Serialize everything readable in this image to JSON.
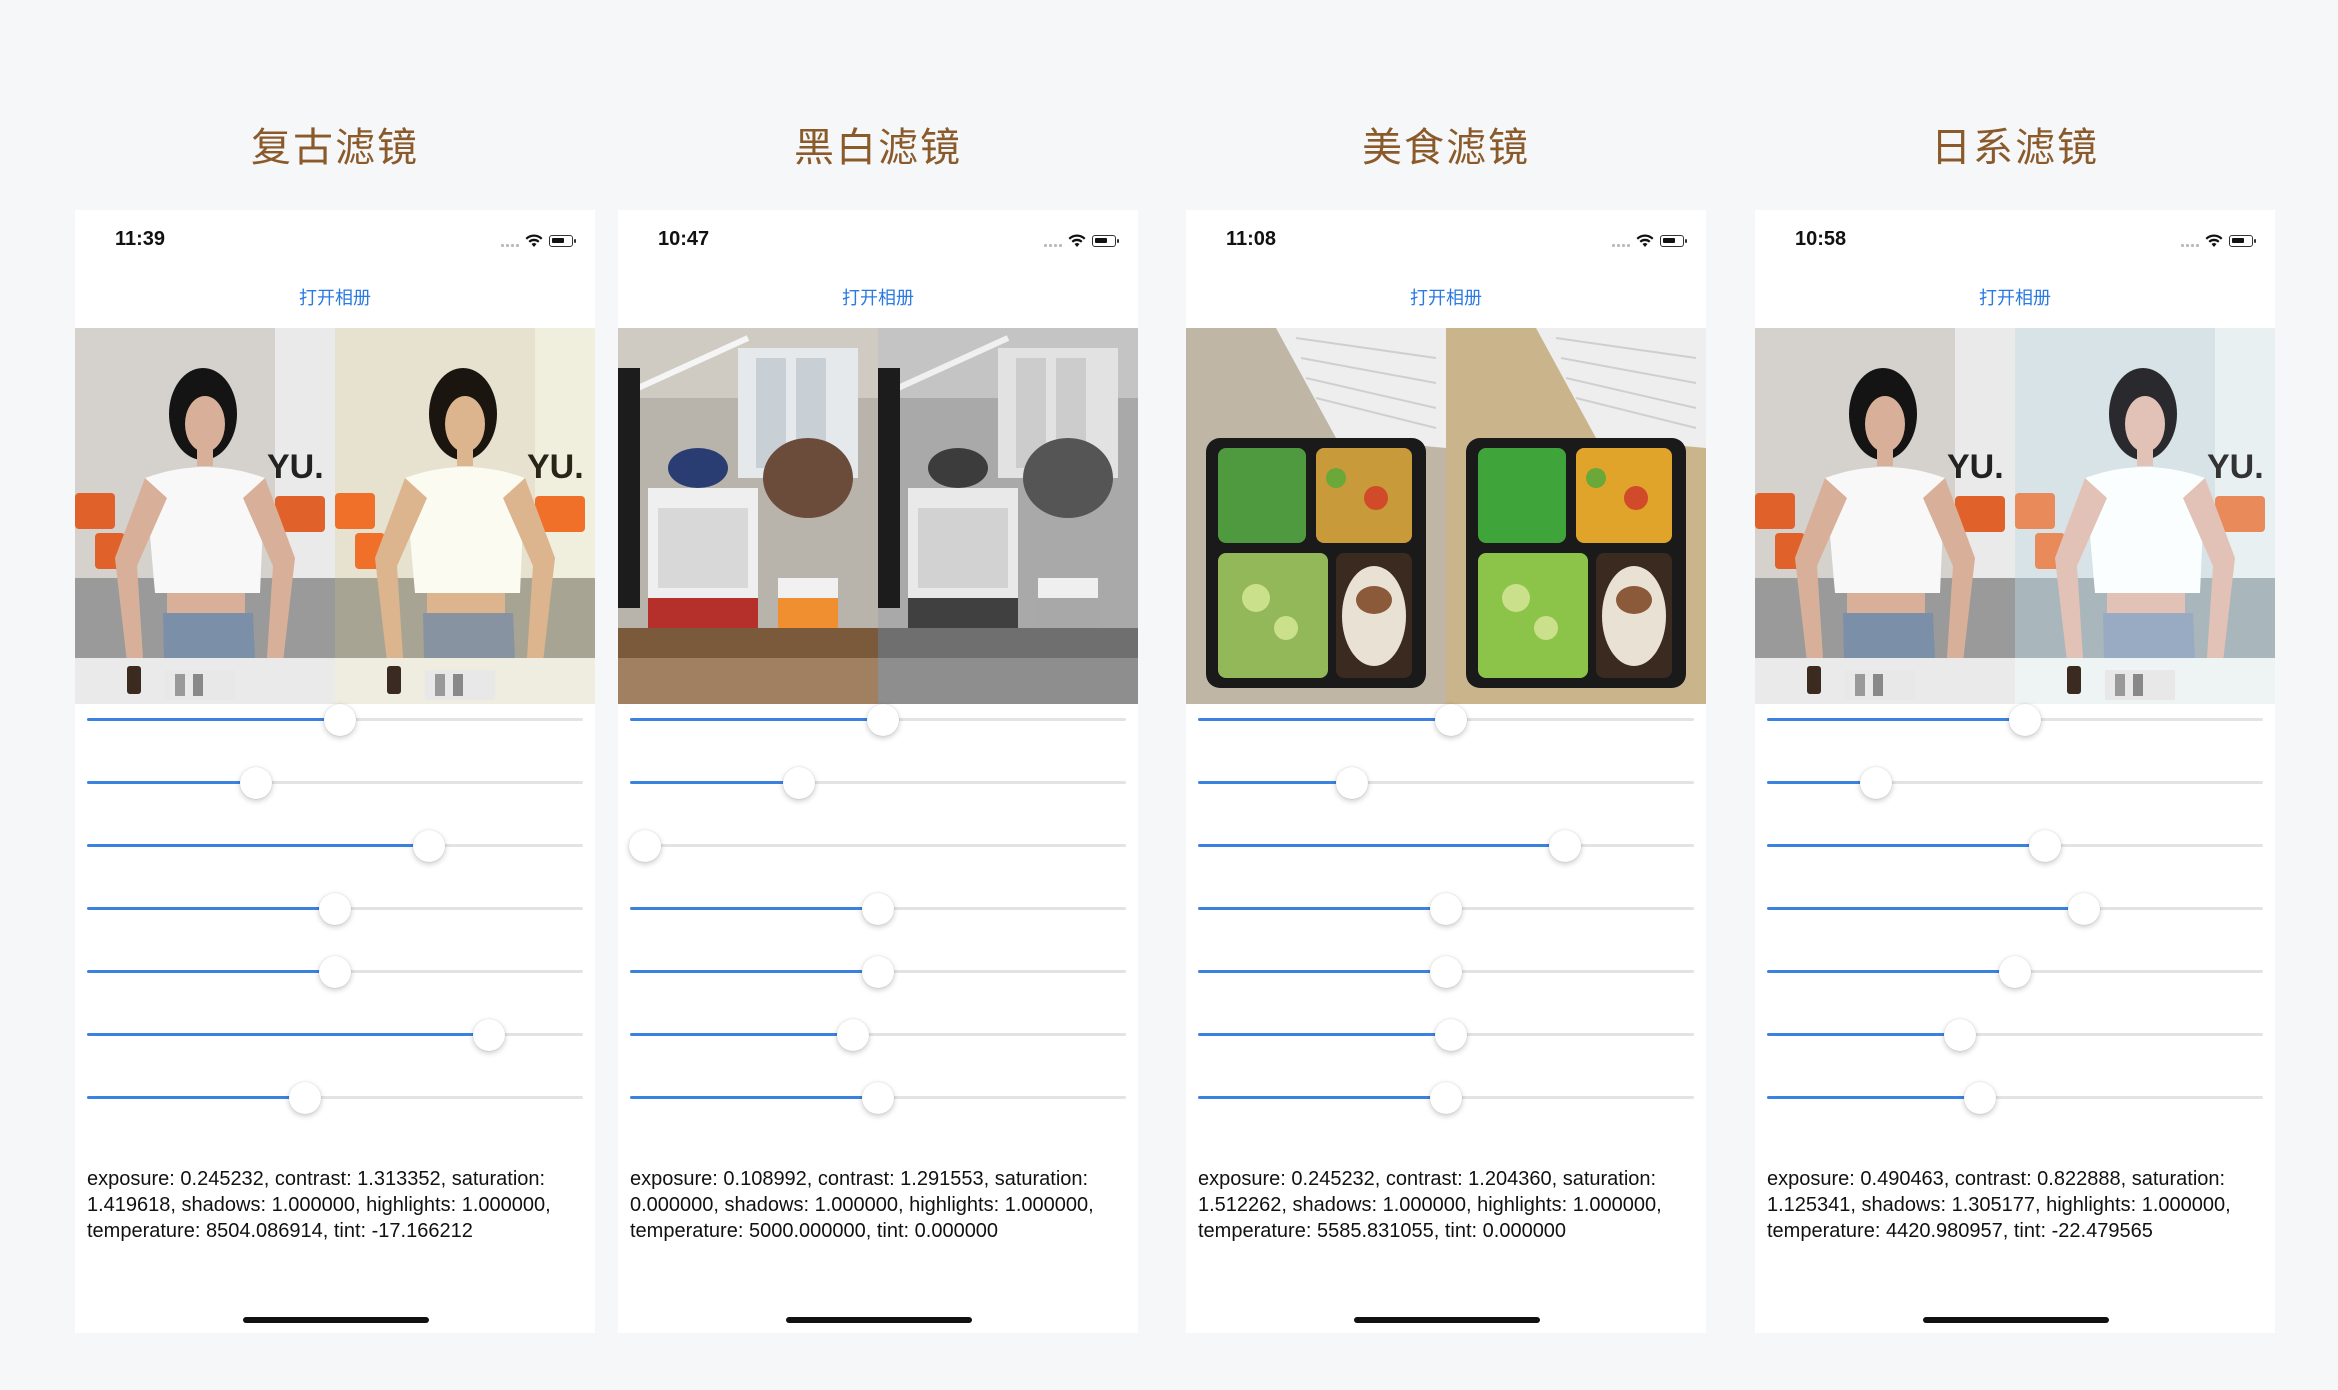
{
  "filters": [
    {
      "title": "复古滤镜",
      "time": "11:39",
      "open_album": "打开相册",
      "scene": "person",
      "filter_type": "vintage",
      "sliders": [
        0.51,
        0.34,
        0.69,
        0.5,
        0.5,
        0.81,
        0.44
      ],
      "params_text": "exposure: 0.245232, contrast: 1.313352, saturation: 1.419618, shadows: 1.000000, highlights: 1.000000, temperature: 8504.086914, tint: -17.166212"
    },
    {
      "title": "黑白滤镜",
      "time": "10:47",
      "open_album": "打开相册",
      "scene": "office",
      "filter_type": "grayscale",
      "sliders": [
        0.51,
        0.34,
        0.03,
        0.5,
        0.5,
        0.45,
        0.5
      ],
      "params_text": "exposure: 0.108992, contrast: 1.291553, saturation: 0.000000, shadows: 1.000000, highlights: 1.000000, temperature: 5000.000000, tint: 0.000000"
    },
    {
      "title": "美食滤镜",
      "time": "11:08",
      "open_album": "打开相册",
      "scene": "food",
      "filter_type": "food",
      "sliders": [
        0.51,
        0.31,
        0.74,
        0.5,
        0.5,
        0.51,
        0.5
      ],
      "params_text": "exposure: 0.245232, contrast: 1.204360, saturation: 1.512262, shadows: 1.000000, highlights: 1.000000, temperature: 5585.831055, tint: 0.000000"
    },
    {
      "title": "日系滤镜",
      "time": "10:58",
      "open_album": "打开相册",
      "scene": "person",
      "filter_type": "japanese",
      "sliders": [
        0.52,
        0.22,
        0.56,
        0.64,
        0.5,
        0.39,
        0.43
      ],
      "params_text": "exposure: 0.490463, contrast: 0.822888, saturation: 1.125341, shadows: 1.305177, highlights: 1.000000, temperature: 4420.980957, tint: -22.479565"
    }
  ],
  "colors": {
    "title": "#8a5a2b",
    "accent": "#3b82e0",
    "link": "#2a7ae2",
    "track": "#e3e3e6",
    "background": "#f6f7f9"
  },
  "icons": [
    "signal-icon",
    "wifi-icon",
    "battery-icon"
  ]
}
